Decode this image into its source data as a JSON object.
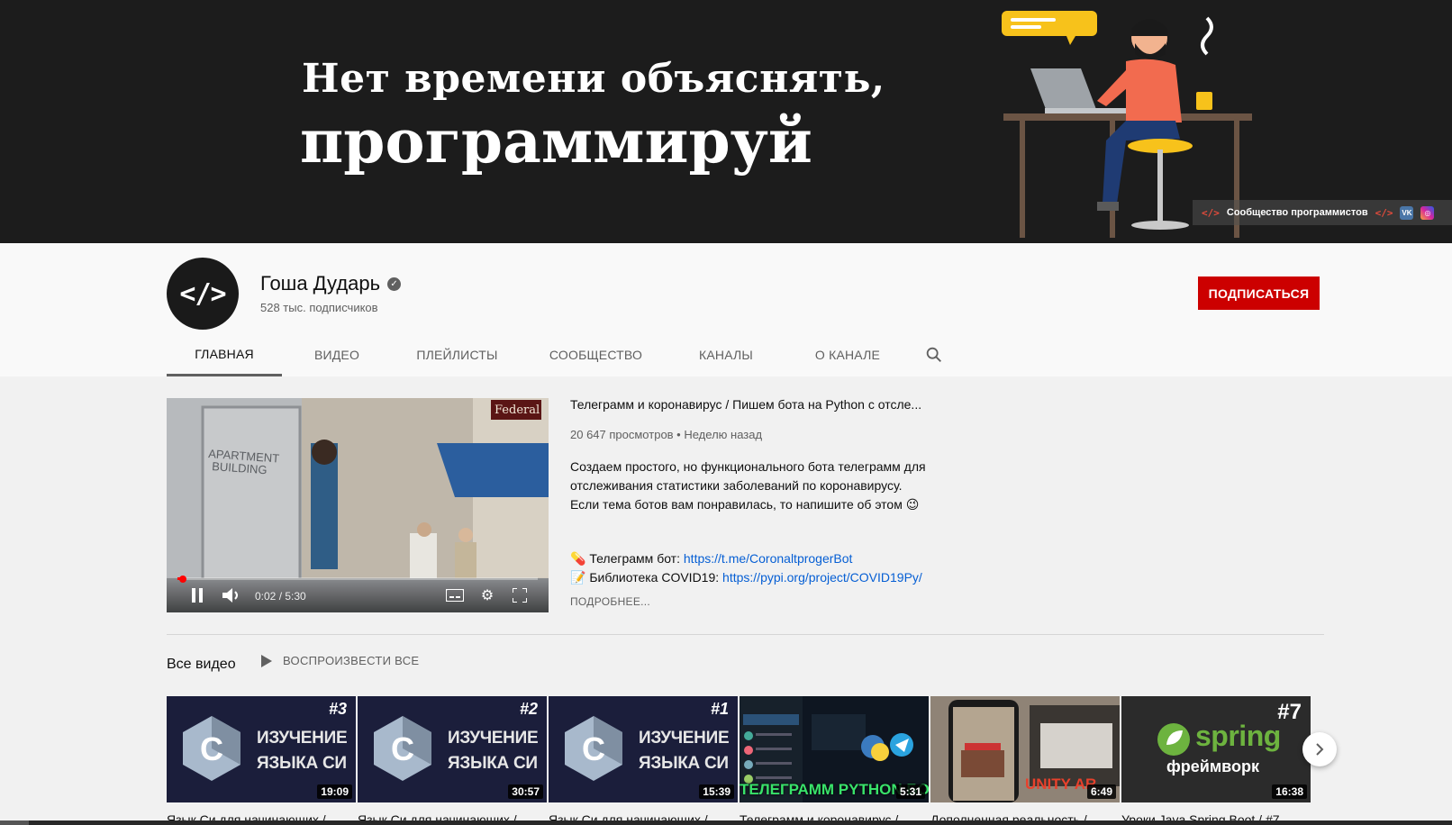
{
  "banner": {
    "line1": "Нет времени объяснять,",
    "line2": "программируй",
    "community_link": "Сообщество программистов",
    "social": [
      "vk-icon",
      "instagram-icon"
    ]
  },
  "channel": {
    "avatar_text": "</>",
    "name": "Гоша Дударь",
    "subscribers": "528 тыс. подписчиков",
    "subscribe_label": "ПОДПИСАТЬСЯ"
  },
  "tabs": [
    "ГЛАВНАЯ",
    "ВИДЕО",
    "ПЛЕЙЛИСТЫ",
    "СООБЩЕСТВО",
    "КАНАЛЫ",
    "О КАНАЛЕ"
  ],
  "featured": {
    "title": "Телеграмм и коронавирус / Пишем бота на Python с отсле...",
    "meta": "20 647 просмотров • Неделю назад",
    "description": "Создаем простого, но функционального бота телеграмм для отслеживания статистики заболеваний по коронавирусу. Если тема ботов вам понравилась, то напишите об этом 😉",
    "bot_label": "Телеграмм бот:",
    "bot_link": "https://t.me/CoronaltprogerBot",
    "lib_label": "Библиотека COVID19:",
    "lib_link": "https://pypi.org/project/COVID19Py/",
    "more": "ПОДРОБНЕЕ...",
    "time": "0:02 / 5:30",
    "scene_door_text": "APARTMENT BUILDING",
    "scene_sign": "Federal",
    "progress": 0.006
  },
  "section": {
    "title": "Все видео",
    "play_all": "ВОСПРОИЗВЕСТИ ВСЕ"
  },
  "videos": [
    {
      "num": "#3",
      "line1": "ИЗУЧЕНИЕ",
      "line2": "ЯЗЫКА СИ",
      "duration": "19:09",
      "title": "Язык Си для начинающих / ..."
    },
    {
      "num": "#2",
      "line1": "ИЗУЧЕНИЕ",
      "line2": "ЯЗЫКА СИ",
      "duration": "30:57",
      "title": "Язык Си для начинающих / ..."
    },
    {
      "num": "#1",
      "line1": "ИЗУЧЕНИЕ",
      "line2": "ЯЗЫКА СИ",
      "duration": "15:39",
      "title": "Язык Си для начинающих / ..."
    },
    {
      "overlay": "ТЕЛЕГРАММ PYTHON БОТ",
      "duration": "5:31",
      "title": "Телеграмм и коронавирус / ..."
    },
    {
      "overlay": "UNITY AR",
      "duration": "6:49",
      "title": "Дополненная реальность / ..."
    },
    {
      "num": "#7",
      "brand": "spring",
      "subtitle": "фреймворк",
      "duration": "16:38",
      "title": "Уроки Java Spring Boot / #7..."
    }
  ],
  "colors": {
    "subscribe": "#cc0000",
    "link": "#065fd4",
    "banner_bg": "#1c1c1c",
    "c_thumb_bg": "#1b1e3b",
    "spring_green": "#6db33f"
  }
}
